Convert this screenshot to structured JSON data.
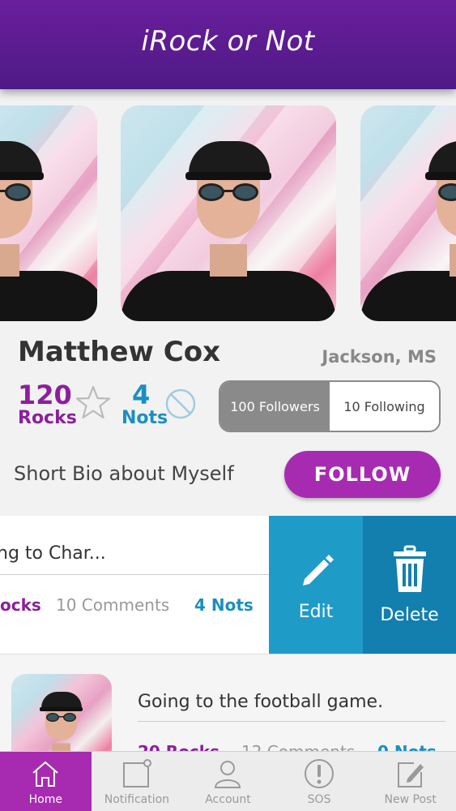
{
  "header": {
    "title": "iRock or Not"
  },
  "profile": {
    "name": "Matthew Cox",
    "location": "Jackson, MS",
    "rocks_count": "120",
    "rocks_label": "Rocks",
    "nots_count": "4",
    "nots_label": "Nots",
    "followers_label": "100 Followers",
    "following_label": "10 Following",
    "bio": "Short Bio about Myself",
    "follow_label": "FOLLOW"
  },
  "swiped_post": {
    "title": "ng to Char...",
    "rocks": "ocks",
    "comments": "10 Comments",
    "nots": "4 Nots",
    "edit_label": "Edit",
    "delete_label": "Delete"
  },
  "post2": {
    "title": "Going to the football game.",
    "rocks": "20 Rocks",
    "comments": "12 Comments",
    "nots": "0 Nots"
  },
  "tabs": [
    {
      "label": "Home",
      "icon": "home-icon",
      "active": true
    },
    {
      "label": "Notification",
      "icon": "notification-icon",
      "active": false
    },
    {
      "label": "Account",
      "icon": "account-icon",
      "active": false
    },
    {
      "label": "SOS",
      "icon": "sos-icon",
      "active": false
    },
    {
      "label": "New Post",
      "icon": "new-post-icon",
      "active": false
    }
  ],
  "colors": {
    "header": "#5a1c90",
    "rocks": "#8c1f9c",
    "nots": "#1b8fc0",
    "follow_button": "#a72bb0",
    "edit": "#1e9cc7",
    "delete": "#127fae",
    "active_tab": "#a72bb0"
  }
}
